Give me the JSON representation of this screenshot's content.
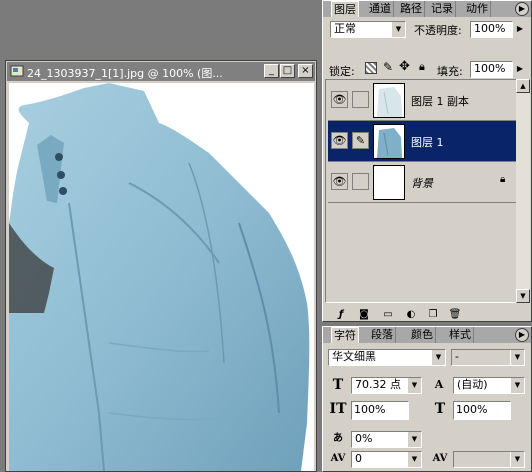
{
  "document": {
    "title": "24_1303937_1[1].jpg @ 100% (图...",
    "buttons": {
      "minimize": "_",
      "maximize": "□",
      "close": "×"
    }
  },
  "layers_panel": {
    "tabs": [
      "图层",
      "通道",
      "路径",
      "记录",
      "动作"
    ],
    "menu_icon": "triangle-right-icon",
    "blend_mode": "正常",
    "opacity_label": "不透明度:",
    "opacity_value": "100%",
    "lock_label": "锁定:",
    "fill_label": "填充:",
    "fill_value": "100%",
    "layers": [
      {
        "name": "图层 1 副本",
        "visible": true,
        "selected": false
      },
      {
        "name": "图层 1",
        "visible": true,
        "selected": true
      },
      {
        "name": "背景",
        "visible": true,
        "selected": false,
        "locked": true
      }
    ]
  },
  "char_panel": {
    "tabs": [
      "字符",
      "段落",
      "颜色",
      "样式"
    ],
    "font_family": "华文细黑",
    "font_style": "-",
    "font_size": "70.32 点",
    "leading": "(自动)",
    "vertical_scale": "100%",
    "horizontal_scale": "100%",
    "tracking_percent": "0%",
    "tracking": "0"
  },
  "colors": {
    "selection": "#0a246a",
    "panel_bg": "#d4d0c8",
    "jacket": "#9cc4d8"
  }
}
